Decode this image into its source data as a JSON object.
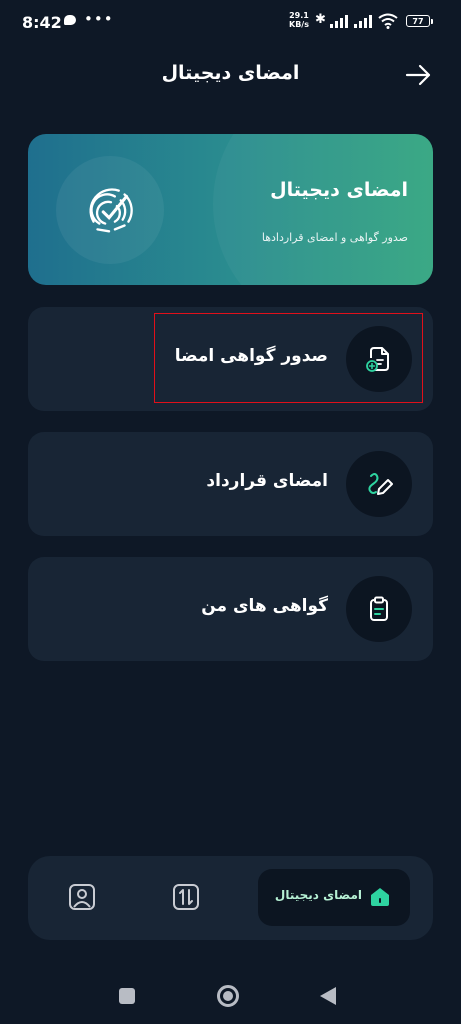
{
  "status_bar": {
    "time": "8:42",
    "net_rate_value": "29.1",
    "net_rate_unit": "KB/s",
    "battery": "77"
  },
  "header": {
    "title": "امضای دیجیتال"
  },
  "banner": {
    "title": "امضای دیجیتال",
    "subtitle": "صدور گواهی و امضای قراردادها"
  },
  "menu": {
    "items": [
      {
        "label": "صدور گواهی امضا",
        "icon": "certificate-add-icon"
      },
      {
        "label": "امضای قرارداد",
        "icon": "signature-pen-icon"
      },
      {
        "label": "گواهی های من",
        "icon": "clipboard-icon"
      }
    ]
  },
  "bottom_nav": {
    "active_label": "امضای دیجیتال",
    "items": [
      "home-icon",
      "transactions-icon",
      "profile-icon"
    ]
  },
  "colors": {
    "background": "#0e1826",
    "card": "#182535",
    "accent": "#2ed3a0",
    "highlight_border": "#e0101a"
  }
}
